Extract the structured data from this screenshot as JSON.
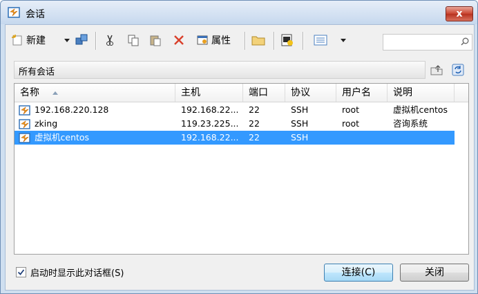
{
  "window": {
    "title": "会话",
    "close_label": "x"
  },
  "toolbar": {
    "new_label": "新建",
    "properties_label": "属性",
    "search_value": "",
    "search_placeholder": ""
  },
  "path": {
    "text": "所有会话"
  },
  "list": {
    "columns": [
      "名称",
      "主机",
      "端口",
      "协议",
      "用户名",
      "说明"
    ],
    "rows": [
      {
        "name": "192.168.220.128",
        "host": "192.168.22...",
        "port": "22",
        "protocol": "SSH",
        "user": "root",
        "note": "虚拟机centos",
        "selected": false
      },
      {
        "name": "zking",
        "host": "119.23.225...",
        "port": "22",
        "protocol": "SSH",
        "user": "root",
        "note": "咨询系统",
        "selected": false
      },
      {
        "name": "虚拟机centos",
        "host": "192.168.22...",
        "port": "22",
        "protocol": "SSH",
        "user": "",
        "note": "",
        "selected": true
      }
    ]
  },
  "footer": {
    "show_on_startup_label": "启动时显示此对话框(S)",
    "show_on_startup_checked": true,
    "connect_label": "连接(C)",
    "close_label": "关闭"
  },
  "colors": {
    "selection": "#3399ff",
    "accent": "#d9412c"
  }
}
